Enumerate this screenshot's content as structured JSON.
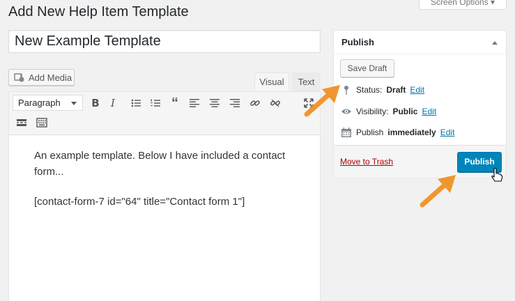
{
  "page": {
    "title": "Add New Help Item Template"
  },
  "screen_options": {
    "label": "Screen Options ▾"
  },
  "post_title": {
    "value": "New Example Template"
  },
  "media": {
    "add_label": "Add Media"
  },
  "editor_tabs": {
    "visual": "Visual",
    "text": "Text"
  },
  "toolbar": {
    "format": "Paragraph"
  },
  "content": {
    "line1": "An example template. Below I have included a contact form...",
    "line2": "[contact-form-7 id=\"64\" title=\"Contact form 1\"]"
  },
  "publish": {
    "title": "Publish",
    "save_draft": "Save Draft",
    "status_label": "Status:",
    "status_value": "Draft",
    "visibility_label": "Visibility:",
    "visibility_value": "Public",
    "schedule_label": "Publish",
    "schedule_value": "immediately",
    "edit": "Edit",
    "trash": "Move to Trash",
    "button": "Publish"
  },
  "colors": {
    "accent": "#0085ba",
    "link": "#0073aa",
    "trash": "#aa0000",
    "annotation_arrow": "#f0962e"
  }
}
